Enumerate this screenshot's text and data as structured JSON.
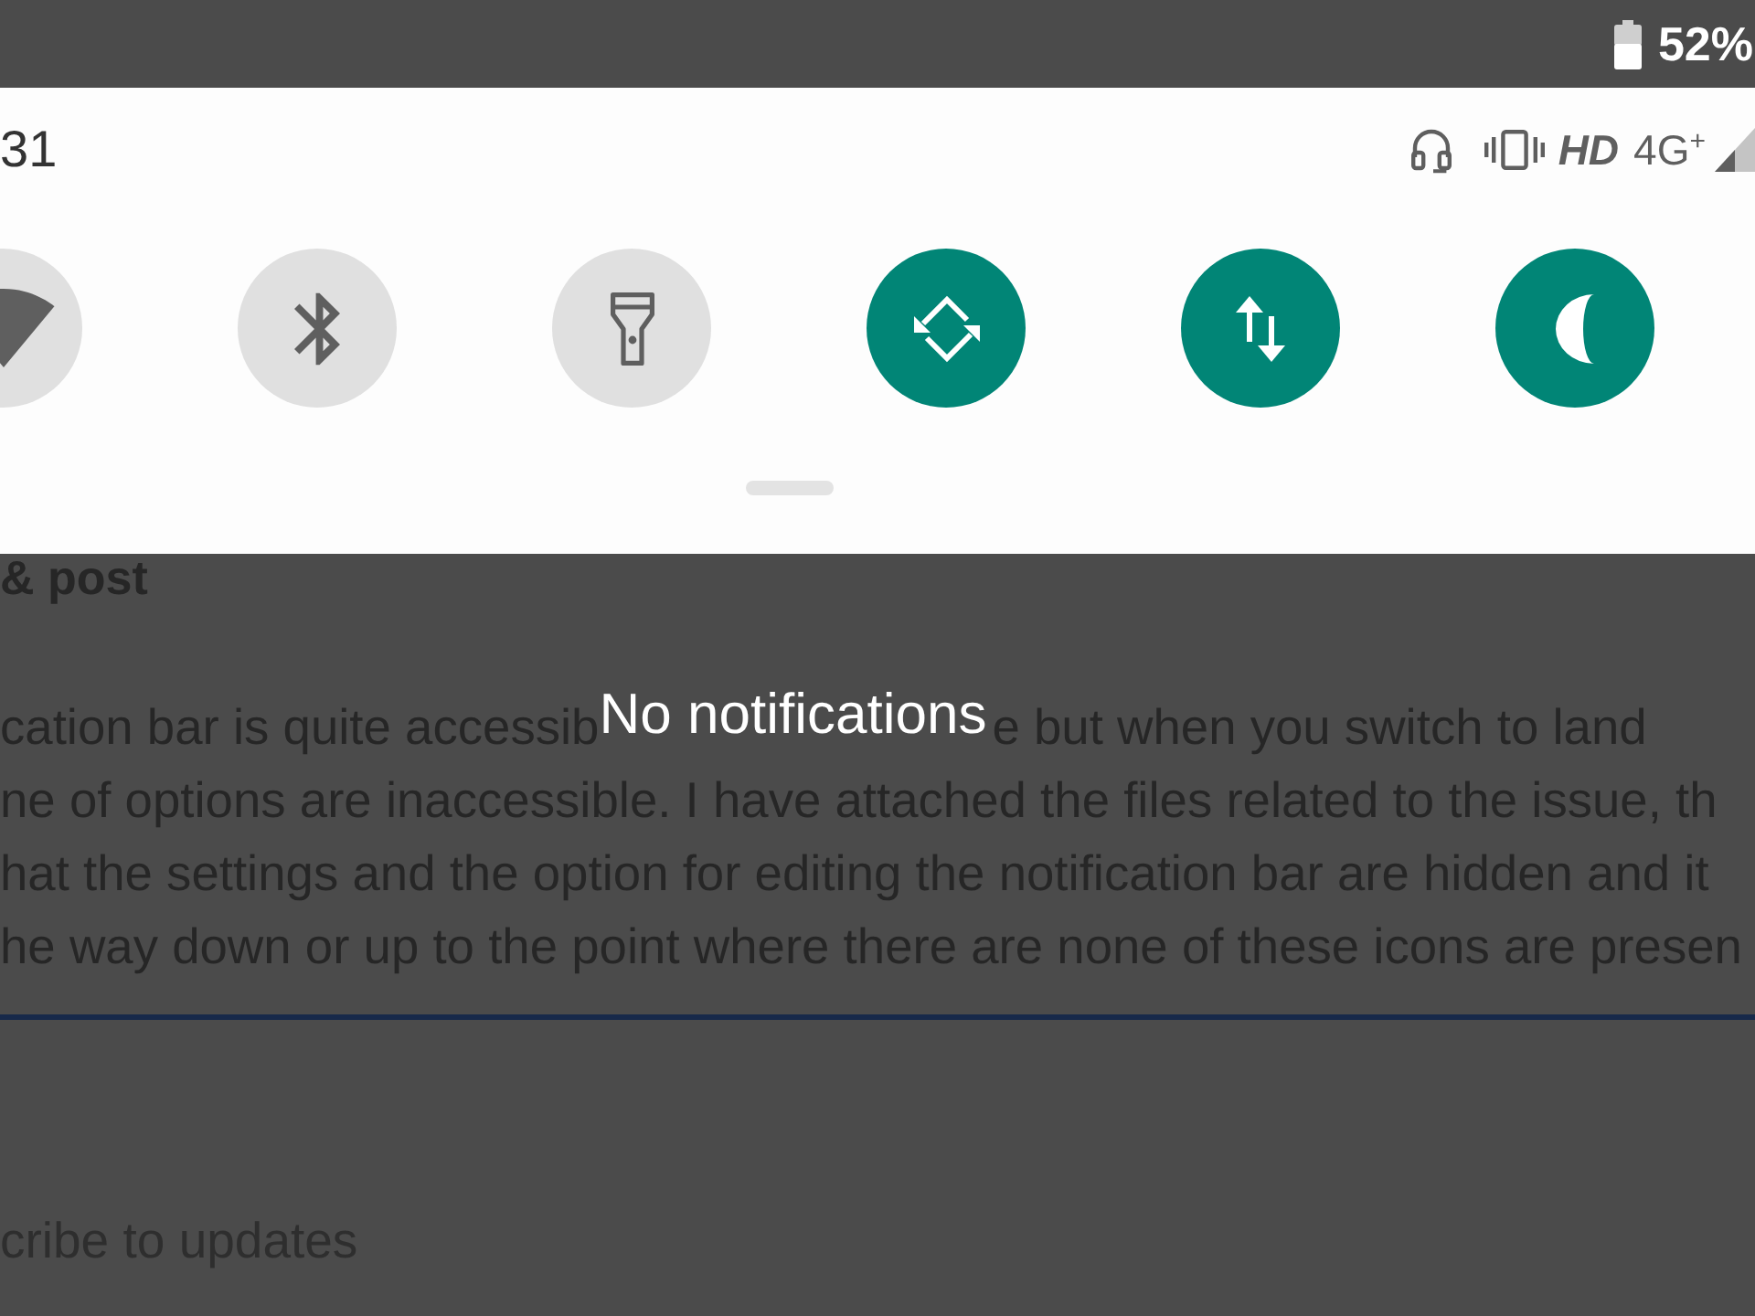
{
  "status_bar": {
    "battery": "52%"
  },
  "quick_settings": {
    "time": "31",
    "hd": "HD",
    "network": "4G$^{+}$",
    "tiles": [
      {
        "kind": "wifi",
        "on": false
      },
      {
        "kind": "bluetooth",
        "on": false
      },
      {
        "kind": "flashlight",
        "on": false
      },
      {
        "kind": "auto_rotate",
        "on": true
      },
      {
        "kind": "mobile_data",
        "on": true
      },
      {
        "kind": "do_not_disturb",
        "on": true
      }
    ]
  },
  "notifications": {
    "empty_message": "No notifications"
  },
  "page": {
    "heading": "& post",
    "first_line_before": "cation bar is quite accessib",
    "first_line_after": "e but when you switch to land",
    "paragraph_lines": [
      "ne of options are inaccessible. I have attached the files related to the issue, th",
      "hat the settings and the option for editing the notification bar are hidden and it",
      "he way down or up to the point where there are none of these icons are presen"
    ],
    "subscribe": "cribe to updates"
  }
}
